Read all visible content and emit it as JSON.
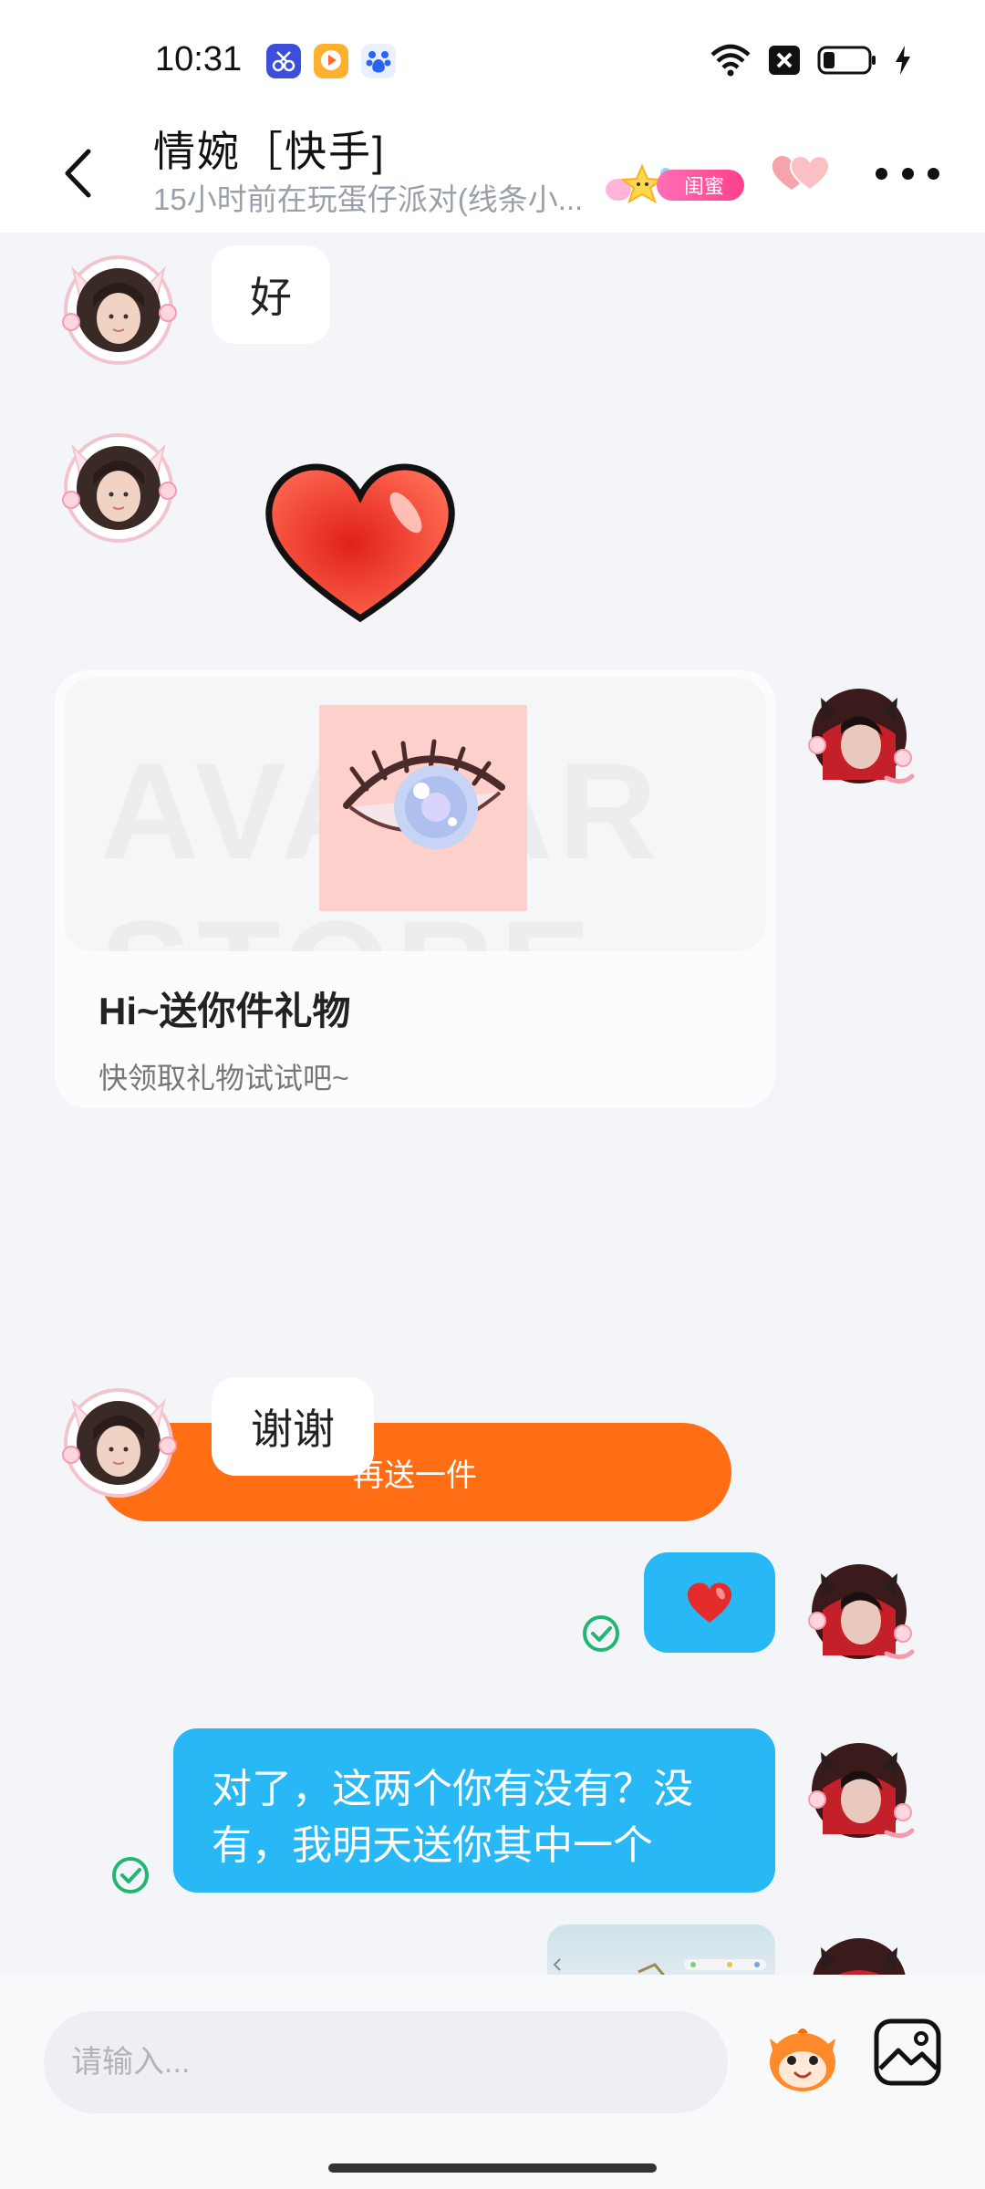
{
  "status_bar": {
    "time": "10:31",
    "icons": [
      "scissors-app-icon",
      "video-app-icon",
      "baidu-app-icon",
      "wifi-icon",
      "sim-off-icon",
      "battery-icon",
      "charging-icon"
    ]
  },
  "header": {
    "back_icon": "chevron-left-icon",
    "title": "情婉［快手]",
    "subtitle": "15小时前在玩蛋仔派对(线条小...",
    "relation_tag": "闺蜜",
    "heart_icon": "double-heart-icon",
    "more_icon": "more-dots-icon"
  },
  "messages": [
    {
      "sender": "other",
      "type": "text",
      "text": "好"
    },
    {
      "sender": "other",
      "type": "sticker",
      "sticker": "red-heart-icon"
    },
    {
      "sender": "self",
      "type": "gift_card",
      "watermark": "AVATAR STORE",
      "title": "Hi~送你件礼物",
      "desc": "快领取礼物试试吧~",
      "button": "再送一件"
    },
    {
      "sender": "other",
      "type": "text",
      "text": "谢谢"
    },
    {
      "sender": "self",
      "type": "emoji",
      "emoji": "❤️",
      "status": "read"
    },
    {
      "sender": "self",
      "type": "text",
      "text_line1": "对了，这两个你有没有？没",
      "text_line2": "有，我明天送你其中一个",
      "status": "read"
    },
    {
      "sender": "self",
      "type": "image",
      "image": "screenshot-thumbnail"
    }
  ],
  "input_bar": {
    "placeholder": "请输入...",
    "emoji_icon": "mascot-emoji-icon",
    "image_icon": "image-picker-icon"
  },
  "colors": {
    "accent_orange": "#ff6e14",
    "outgoing_bubble": "#28b8f5",
    "background": "#f3f5f9",
    "read_check": "#22b573"
  }
}
